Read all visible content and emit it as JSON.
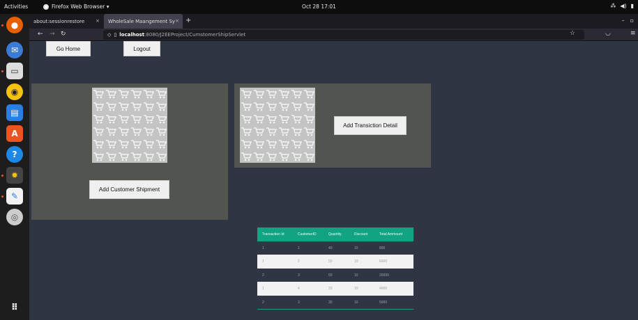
{
  "topbar": {
    "activities": "Activities",
    "app_name": "Firefox Web Browser ▾",
    "clock": "Oct 28  17:01"
  },
  "browser": {
    "tabs": [
      {
        "label": "about:sessionrestore"
      },
      {
        "label": "WholeSale Maangement Sy"
      }
    ],
    "url_host": "localhost",
    "url_path": ":8080/J2EEProject/CumstomerShipServlet"
  },
  "page": {
    "go_home": "Go Home",
    "logout": "Logout",
    "add_shipment": "Add Customer Shipment",
    "add_transaction": "Add Transiction Detail"
  },
  "table": {
    "headers": [
      "Transaction Id",
      "CustomerID",
      "Quantity",
      "Discount",
      "Total Ammount"
    ],
    "rows": [
      [
        "1",
        "1",
        "40",
        "10",
        "800"
      ],
      [
        "1",
        "2",
        "50",
        "10",
        "6000"
      ],
      [
        "2",
        "3",
        "50",
        "10",
        "20000"
      ],
      [
        "1",
        "4",
        "20",
        "10",
        "4000"
      ],
      [
        "2",
        "3",
        "30",
        "10",
        "5000"
      ]
    ]
  },
  "colors": {
    "table_header": "#12a383",
    "panel": "#52554f",
    "page_bg": "#2f3542"
  }
}
